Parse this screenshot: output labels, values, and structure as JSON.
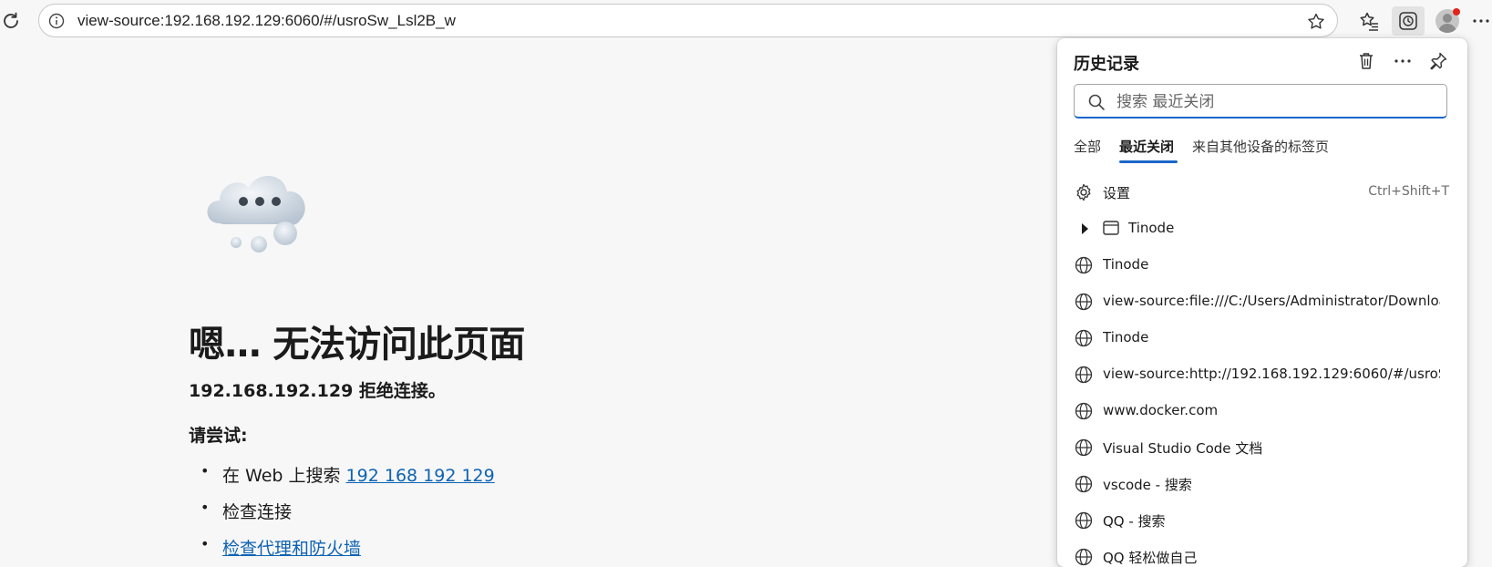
{
  "browser": {
    "url": "view-source:192.168.192.129:6060/#/usroSw_Lsl2B_w"
  },
  "error_page": {
    "title": "嗯… 无法访问此页面",
    "subtitle": "192.168.192.129 拒绝连接。",
    "try_label": "请尝试:",
    "suggestions": [
      {
        "prefix": "在 Web 上搜索 ",
        "link": "192 168 192 129"
      },
      {
        "text": "检查连接"
      },
      {
        "link": "检查代理和防火墙"
      }
    ]
  },
  "history": {
    "title": "历史记录",
    "search_placeholder": "搜索 最近关闭",
    "tabs": [
      "全部",
      "最近关闭",
      "来自其他设备的标签页"
    ],
    "active_tab": "最近关闭",
    "settings_label": "设置",
    "settings_shortcut": "Ctrl+Shift+T",
    "items": [
      {
        "label": "Tinode",
        "type": "window"
      },
      {
        "label": "Tinode",
        "type": "page"
      },
      {
        "label": "view-source:file:///C:/Users/Administrator/Downloads/...",
        "type": "page"
      },
      {
        "label": "Tinode",
        "type": "page"
      },
      {
        "label": "view-source:http://192.168.192.129:6060/#/usroSw_Lsl...",
        "type": "page"
      },
      {
        "label": "www.docker.com",
        "type": "page"
      },
      {
        "label": "Visual Studio Code 文档",
        "type": "page"
      },
      {
        "label": "vscode - 搜索",
        "type": "page"
      },
      {
        "label": "QQ - 搜索",
        "type": "page"
      },
      {
        "label": "QQ 轻松做自己",
        "type": "page"
      }
    ]
  },
  "colors": {
    "accent": "#1b66c9",
    "link": "#0e63b3",
    "notification_dot": "#e0251b"
  }
}
